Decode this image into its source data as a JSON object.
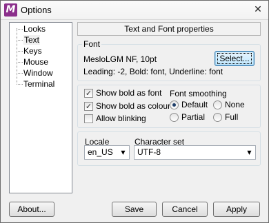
{
  "window": {
    "title": "Options",
    "app_icon_letter": "M",
    "close_symbol": "✕"
  },
  "nav": {
    "items": [
      {
        "label": "Looks"
      },
      {
        "label": "Text",
        "selected": true
      },
      {
        "label": "Keys"
      },
      {
        "label": "Mouse"
      },
      {
        "label": "Window"
      },
      {
        "label": "Terminal"
      }
    ]
  },
  "panel": {
    "header": "Text and Font properties",
    "font_group": {
      "title": "Font",
      "font_name": "MesloLGM NF, 10pt",
      "details": "Leading: -2, Bold: font, Underline: font",
      "select_button": "Select..."
    },
    "options": {
      "show_bold_as_font": {
        "label": "Show bold as font",
        "checked": true
      },
      "show_bold_as_colour": {
        "label": "Show bold as colour",
        "checked": true
      },
      "allow_blinking": {
        "label": "Allow blinking",
        "checked": false
      }
    },
    "smoothing": {
      "title": "Font smoothing",
      "default": {
        "label": "Default",
        "selected": true
      },
      "none": {
        "label": "None",
        "selected": false
      },
      "partial": {
        "label": "Partial",
        "selected": false
      },
      "full": {
        "label": "Full",
        "selected": false
      }
    },
    "locale": {
      "label": "Locale",
      "value": "en_US"
    },
    "charset": {
      "label": "Character set",
      "value": "UTF-8"
    }
  },
  "buttons": {
    "about": "About...",
    "save": "Save",
    "cancel": "Cancel",
    "apply": "Apply"
  },
  "icons": {
    "check": "✓",
    "dropdown": "▼"
  }
}
